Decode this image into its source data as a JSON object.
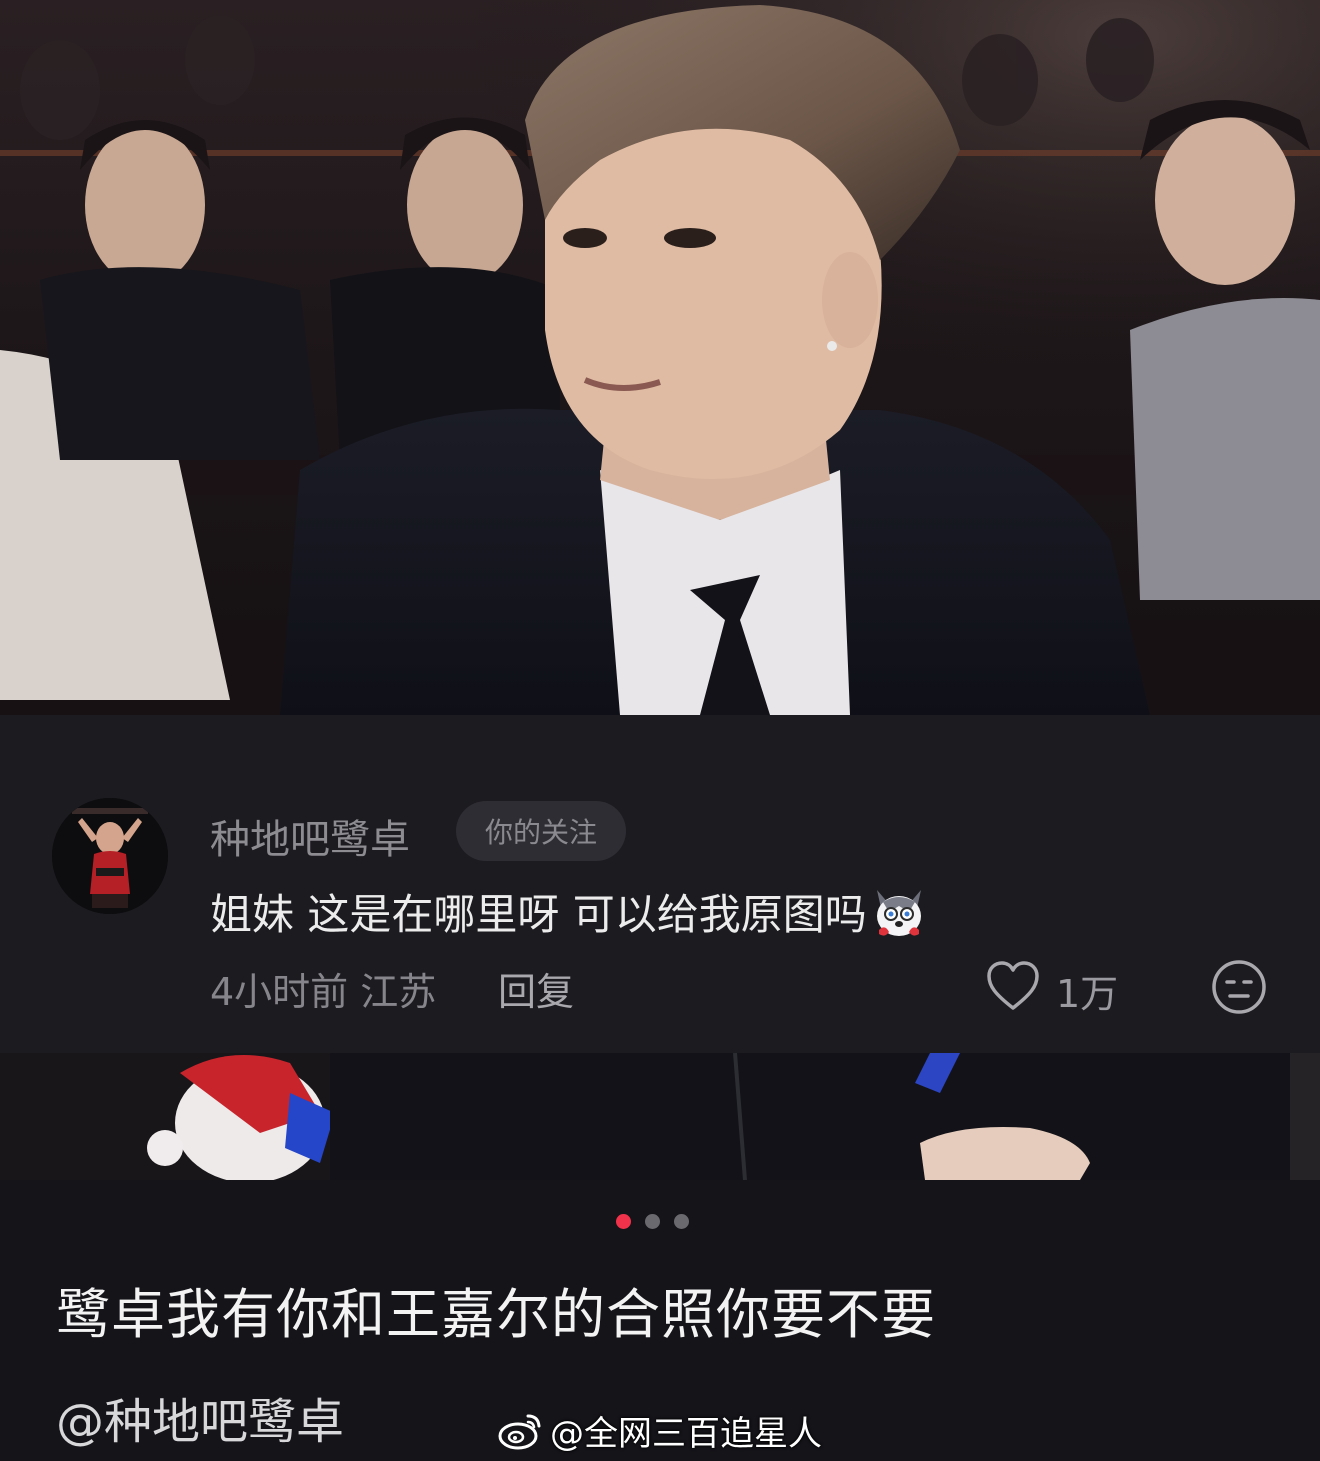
{
  "photo": {
    "top_description_icon": "photo-content",
    "bottom_description_icon": "photo-content"
  },
  "comment": {
    "username": "种地吧鹭卓",
    "follow_badge": "你的关注",
    "text": "姐妹 这是在哪里呀 可以给我原图吗",
    "emoji_icon": "husky-emoji-icon",
    "meta": "4小时前 江苏",
    "reply_label": "回复",
    "likes": "1万",
    "like_icon": "heart-icon",
    "dislike_icon": "unamused-face-icon"
  },
  "carousel": {
    "total": 3,
    "active_index": 0,
    "active_color": "#f0334b",
    "inactive_color": "#6a696e"
  },
  "post": {
    "title": "鹭卓我有你和王嘉尔的合照你要不要",
    "mention": "@种地吧鹭卓"
  },
  "watermark": {
    "icon": "weibo-logo-icon",
    "text": "@全网三百追星人"
  },
  "colors": {
    "background": "#151419",
    "card": "#1c1b20",
    "badge": "#2e2d33"
  }
}
